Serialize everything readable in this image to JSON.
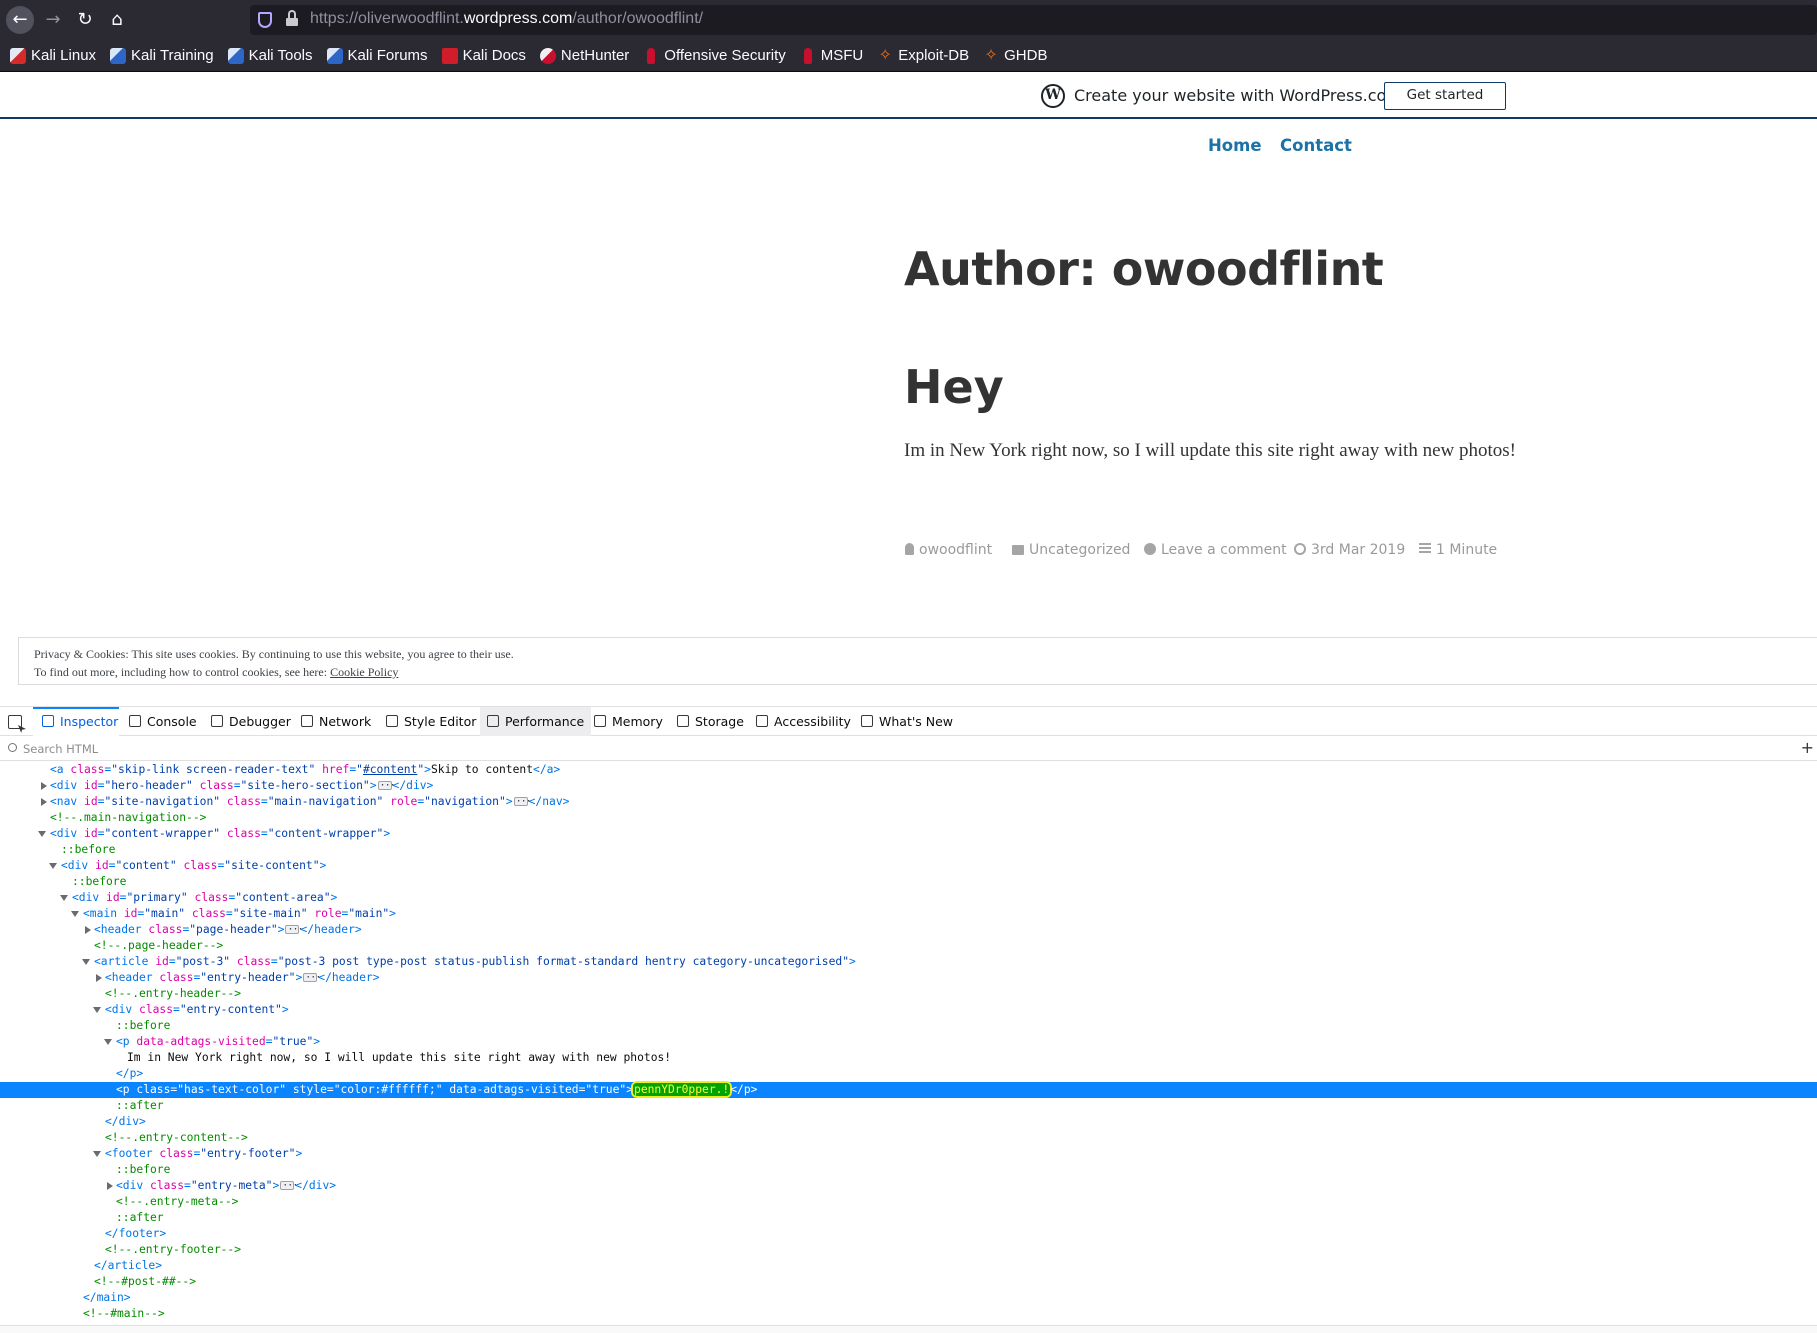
{
  "browser": {
    "url_prefix": "https://oliverwoodflint.",
    "url_host": "wordpress.com",
    "url_path": "/author/owoodflint/"
  },
  "bookmarks": [
    {
      "label": "Kali Linux",
      "icon": "kali-icon"
    },
    {
      "label": "Kali Training",
      "icon": "kali-training-icon"
    },
    {
      "label": "Kali Tools",
      "icon": "kali-tools-icon"
    },
    {
      "label": "Kali Forums",
      "icon": "kali-forums-icon"
    },
    {
      "label": "Kali Docs",
      "icon": "kali-docs-icon"
    },
    {
      "label": "NetHunter",
      "icon": "nethunter-icon"
    },
    {
      "label": "Offensive Security",
      "icon": "offsec-icon"
    },
    {
      "label": "MSFU",
      "icon": "msfu-icon"
    },
    {
      "label": "Exploit-DB",
      "icon": "exploitdb-icon"
    },
    {
      "label": "GHDB",
      "icon": "ghdb-icon"
    }
  ],
  "wp_banner": {
    "text": "Create your website with WordPress.com",
    "button": "Get started"
  },
  "site_nav": {
    "home": "Home",
    "contact": "Contact"
  },
  "content": {
    "page_title": "Author: owoodflint",
    "post_title": "Hey",
    "post_body": "Im in New York right now, so I will update this site right away with new photos!",
    "meta": {
      "author": "owoodflint",
      "category": "Uncategorized",
      "comment": "Leave a comment",
      "date": "3rd Mar 2019",
      "read_time": "1 Minute"
    }
  },
  "cookie": {
    "line1": "Privacy & Cookies: This site uses cookies. By continuing to use this website, you agree to their use.",
    "line2_prefix": "To find out more, including how to control cookies, see here: ",
    "link": "Cookie Policy"
  },
  "devtools": {
    "tabs": {
      "inspector": "Inspector",
      "console": "Console",
      "debugger": "Debugger",
      "network": "Network",
      "style_editor": "Style Editor",
      "performance": "Performance",
      "memory": "Memory",
      "storage": "Storage",
      "accessibility": "Accessibility",
      "whats_new": "What's New"
    },
    "search_placeholder": "Search HTML",
    "hidden_text": "pennYDr0pper.!"
  },
  "colors": {
    "accent": "#0a84ff",
    "link": "#1a73a6",
    "highlight_bg": "#00a300",
    "highlight_fg": "#ffff33"
  }
}
